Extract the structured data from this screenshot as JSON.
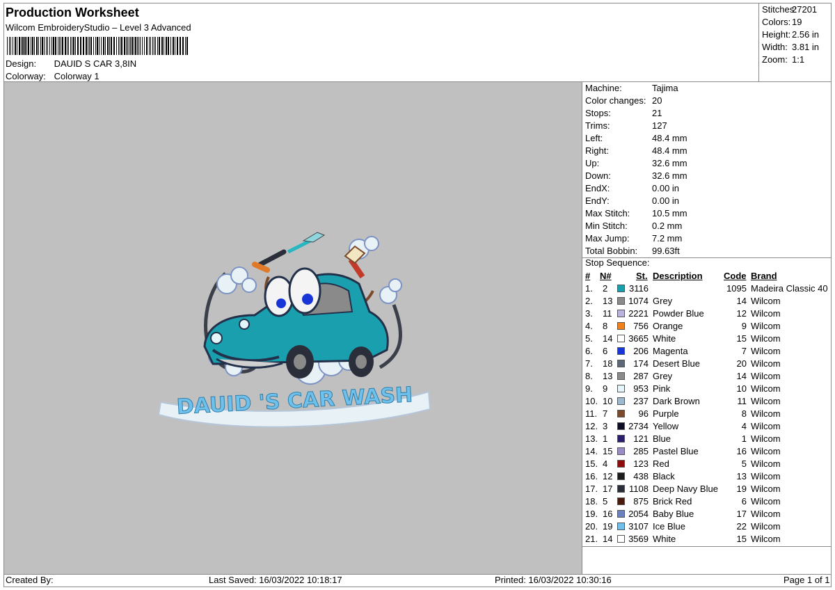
{
  "header": {
    "title": "Production Worksheet",
    "subtitle": "Wilcom EmbroideryStudio – Level 3 Advanced",
    "design_label": "Design:",
    "design_value": "DAUID S CAR 3,8IN",
    "colorway_label": "Colorway:",
    "colorway_value": "Colorway 1"
  },
  "stats": [
    {
      "label": "Stitches:",
      "value": "27201"
    },
    {
      "label": "Colors:",
      "value": "19"
    },
    {
      "label": "Height:",
      "value": "2.56 in"
    },
    {
      "label": "Width:",
      "value": "3.81 in"
    },
    {
      "label": "Zoom:",
      "value": "1:1"
    }
  ],
  "machine_info": [
    {
      "label": "Machine:",
      "value": "Tajima"
    },
    {
      "label": "Color changes:",
      "value": "20"
    },
    {
      "label": "Stops:",
      "value": "21"
    },
    {
      "label": "Trims:",
      "value": "127"
    },
    {
      "label": "Left:",
      "value": "48.4 mm"
    },
    {
      "label": "Right:",
      "value": "48.4 mm"
    },
    {
      "label": "Up:",
      "value": "32.6 mm"
    },
    {
      "label": "Down:",
      "value": "32.6 mm"
    },
    {
      "label": "EndX:",
      "value": "0.00 in"
    },
    {
      "label": "EndY:",
      "value": "0.00 in"
    },
    {
      "label": "Max Stitch:",
      "value": "10.5 mm"
    },
    {
      "label": "Min Stitch:",
      "value": "0.2 mm"
    },
    {
      "label": "Max Jump:",
      "value": "7.2 mm"
    },
    {
      "label": "Total Bobbin:",
      "value": "99.63ft"
    }
  ],
  "stop_sequence": {
    "title": "Stop Sequence:",
    "headers": {
      "num": "#",
      "n": "N#",
      "st": "St.",
      "desc": "Description",
      "code": "Code",
      "brand": "Brand"
    },
    "rows": [
      {
        "num": "1.",
        "n": "2",
        "color": "#1a9fae",
        "st": "3116",
        "desc": "",
        "code": "1095",
        "brand": "Madeira Classic 40"
      },
      {
        "num": "2.",
        "n": "13",
        "color": "#8a8a8a",
        "st": "1074",
        "desc": "Grey",
        "code": "14",
        "brand": "Wilcom"
      },
      {
        "num": "3.",
        "n": "11",
        "color": "#b9b3e0",
        "st": "2221",
        "desc": "Powder Blue",
        "code": "12",
        "brand": "Wilcom"
      },
      {
        "num": "4.",
        "n": "8",
        "color": "#f0801c",
        "st": "756",
        "desc": "Orange",
        "code": "9",
        "brand": "Wilcom"
      },
      {
        "num": "5.",
        "n": "14",
        "color": "#ffffff",
        "st": "3665",
        "desc": "White",
        "code": "15",
        "brand": "Wilcom"
      },
      {
        "num": "6.",
        "n": "6",
        "color": "#1835d8",
        "st": "206",
        "desc": "Magenta",
        "code": "7",
        "brand": "Wilcom"
      },
      {
        "num": "7.",
        "n": "18",
        "color": "#5c6878",
        "st": "174",
        "desc": "Desert Blue",
        "code": "20",
        "brand": "Wilcom"
      },
      {
        "num": "8.",
        "n": "13",
        "color": "#8a8a8a",
        "st": "287",
        "desc": "Grey",
        "code": "14",
        "brand": "Wilcom"
      },
      {
        "num": "9.",
        "n": "9",
        "color": "#e4f4fb",
        "st": "953",
        "desc": "Pink",
        "code": "10",
        "brand": "Wilcom"
      },
      {
        "num": "10.",
        "n": "10",
        "color": "#9cb9d0",
        "st": "237",
        "desc": "Dark Brown",
        "code": "11",
        "brand": "Wilcom"
      },
      {
        "num": "11.",
        "n": "7",
        "color": "#7a4a2a",
        "st": "96",
        "desc": "Purple",
        "code": "8",
        "brand": "Wilcom"
      },
      {
        "num": "12.",
        "n": "3",
        "color": "#0c0c24",
        "st": "2734",
        "desc": "Yellow",
        "code": "4",
        "brand": "Wilcom"
      },
      {
        "num": "13.",
        "n": "1",
        "color": "#2a1f6e",
        "st": "121",
        "desc": "Blue",
        "code": "1",
        "brand": "Wilcom"
      },
      {
        "num": "14.",
        "n": "15",
        "color": "#9a8cc4",
        "st": "285",
        "desc": "Pastel Blue",
        "code": "16",
        "brand": "Wilcom"
      },
      {
        "num": "15.",
        "n": "4",
        "color": "#8e0c0c",
        "st": "123",
        "desc": "Red",
        "code": "5",
        "brand": "Wilcom"
      },
      {
        "num": "16.",
        "n": "12",
        "color": "#1c1c1c",
        "st": "438",
        "desc": "Black",
        "code": "13",
        "brand": "Wilcom"
      },
      {
        "num": "17.",
        "n": "17",
        "color": "#2a2e3a",
        "st": "1108",
        "desc": "Deep Navy Blue",
        "code": "19",
        "brand": "Wilcom"
      },
      {
        "num": "18.",
        "n": "5",
        "color": "#4a1a0c",
        "st": "875",
        "desc": "Brick Red",
        "code": "6",
        "brand": "Wilcom"
      },
      {
        "num": "19.",
        "n": "16",
        "color": "#6a82c0",
        "st": "2054",
        "desc": "Baby Blue",
        "code": "17",
        "brand": "Wilcom"
      },
      {
        "num": "20.",
        "n": "19",
        "color": "#70c0ec",
        "st": "3107",
        "desc": "Ice Blue",
        "code": "22",
        "brand": "Wilcom"
      },
      {
        "num": "21.",
        "n": "14",
        "color": "#ffffff",
        "st": "3569",
        "desc": "White",
        "code": "15",
        "brand": "Wilcom"
      }
    ]
  },
  "footer": {
    "created_by": "Created By:",
    "last_saved": "Last Saved: 16/03/2022 10:18:17",
    "printed": "Printed: 16/03/2022 10:30:16",
    "page": "Page 1 of 1"
  },
  "design_preview": {
    "logo_text": "DAUID 'S CAR WASH"
  }
}
